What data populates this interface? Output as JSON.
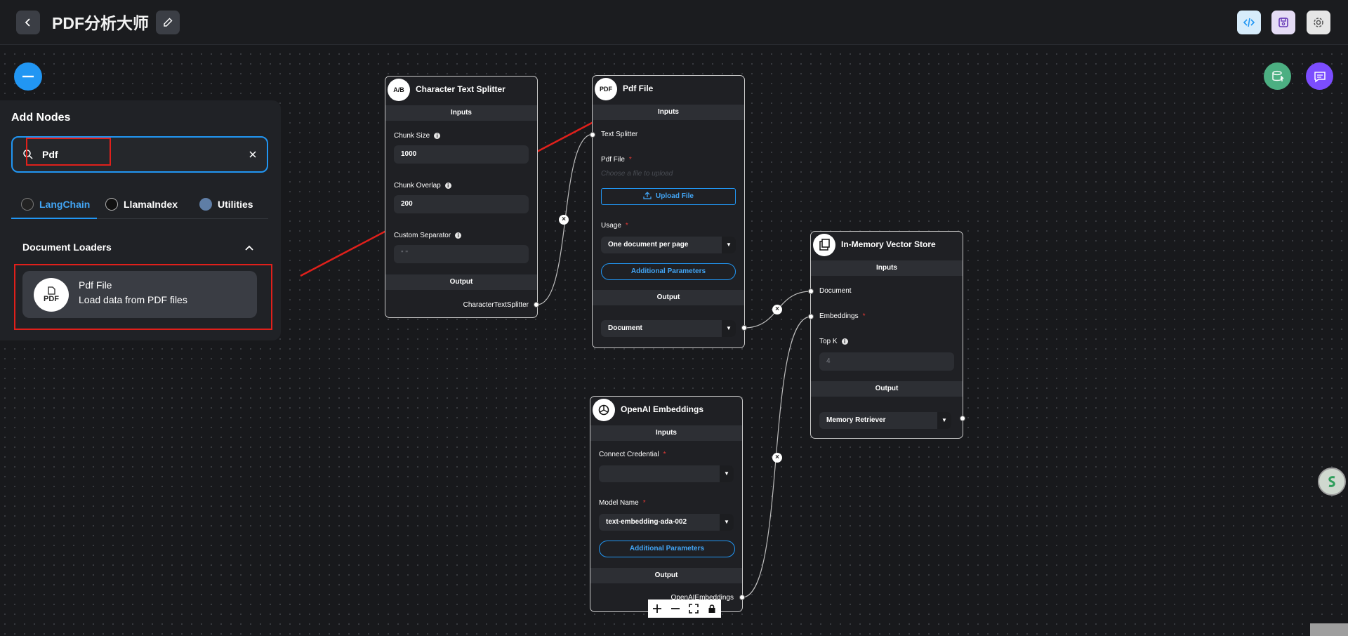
{
  "header": {
    "title": "PDF分析大师",
    "back_icon": "chevron-left-icon",
    "edit_icon": "pencil-icon",
    "actions": [
      {
        "name": "api-code-button",
        "icon": "code-icon",
        "color": "#2196f3"
      },
      {
        "name": "save-button",
        "icon": "save-icon",
        "color": "#673ab7"
      },
      {
        "name": "settings-button",
        "icon": "gear-icon",
        "color": "#616161"
      }
    ]
  },
  "fab": {
    "collapse_icon": "minus-icon",
    "upsert_icon": "database-upload-icon",
    "chat_icon": "chat-icon"
  },
  "add_nodes": {
    "title": "Add Nodes",
    "search_value": "Pdf",
    "tabs": [
      {
        "label": "LangChain",
        "active": true
      },
      {
        "label": "LlamaIndex",
        "active": false
      },
      {
        "label": "Utilities",
        "active": false
      }
    ],
    "category": "Document Loaders",
    "items": [
      {
        "icon_text": "PDF",
        "name": "Pdf File",
        "description": "Load data from PDF files"
      }
    ]
  },
  "nodes": {
    "splitter": {
      "icon_text": "A/B",
      "title": "Character Text Splitter",
      "inputs_label": "Inputs",
      "chunk_size_label": "Chunk Size",
      "chunk_size_value": "1000",
      "chunk_overlap_label": "Chunk Overlap",
      "chunk_overlap_value": "200",
      "separator_label": "Custom Separator",
      "separator_placeholder": "\" \"",
      "output_label": "Output",
      "output_value": "CharacterTextSplitter"
    },
    "pdf": {
      "icon_text": "PDF",
      "title": "Pdf File",
      "inputs_label": "Inputs",
      "text_splitter_label": "Text Splitter",
      "pdf_file_label": "Pdf File",
      "pdf_file_placeholder": "Choose a file to upload",
      "upload_label": "Upload File",
      "usage_label": "Usage",
      "usage_value": "One document per page",
      "additional_label": "Additional Parameters",
      "output_label": "Output",
      "output_value": "Document"
    },
    "vector": {
      "title": "In-Memory Vector Store",
      "inputs_label": "Inputs",
      "document_label": "Document",
      "embeddings_label": "Embeddings",
      "topk_label": "Top K",
      "topk_placeholder": "4",
      "output_label": "Output",
      "output_value": "Memory Retriever"
    },
    "openai": {
      "title": "OpenAI Embeddings",
      "inputs_label": "Inputs",
      "credential_label": "Connect Credential",
      "model_label": "Model Name",
      "model_value": "text-embedding-ada-002",
      "additional_label": "Additional Parameters",
      "output_label": "Output",
      "output_value": "OpenAIEmbeddings"
    }
  },
  "canvas_controls": [
    "zoom-in-icon",
    "zoom-out-icon",
    "fit-view-icon",
    "lock-icon"
  ]
}
